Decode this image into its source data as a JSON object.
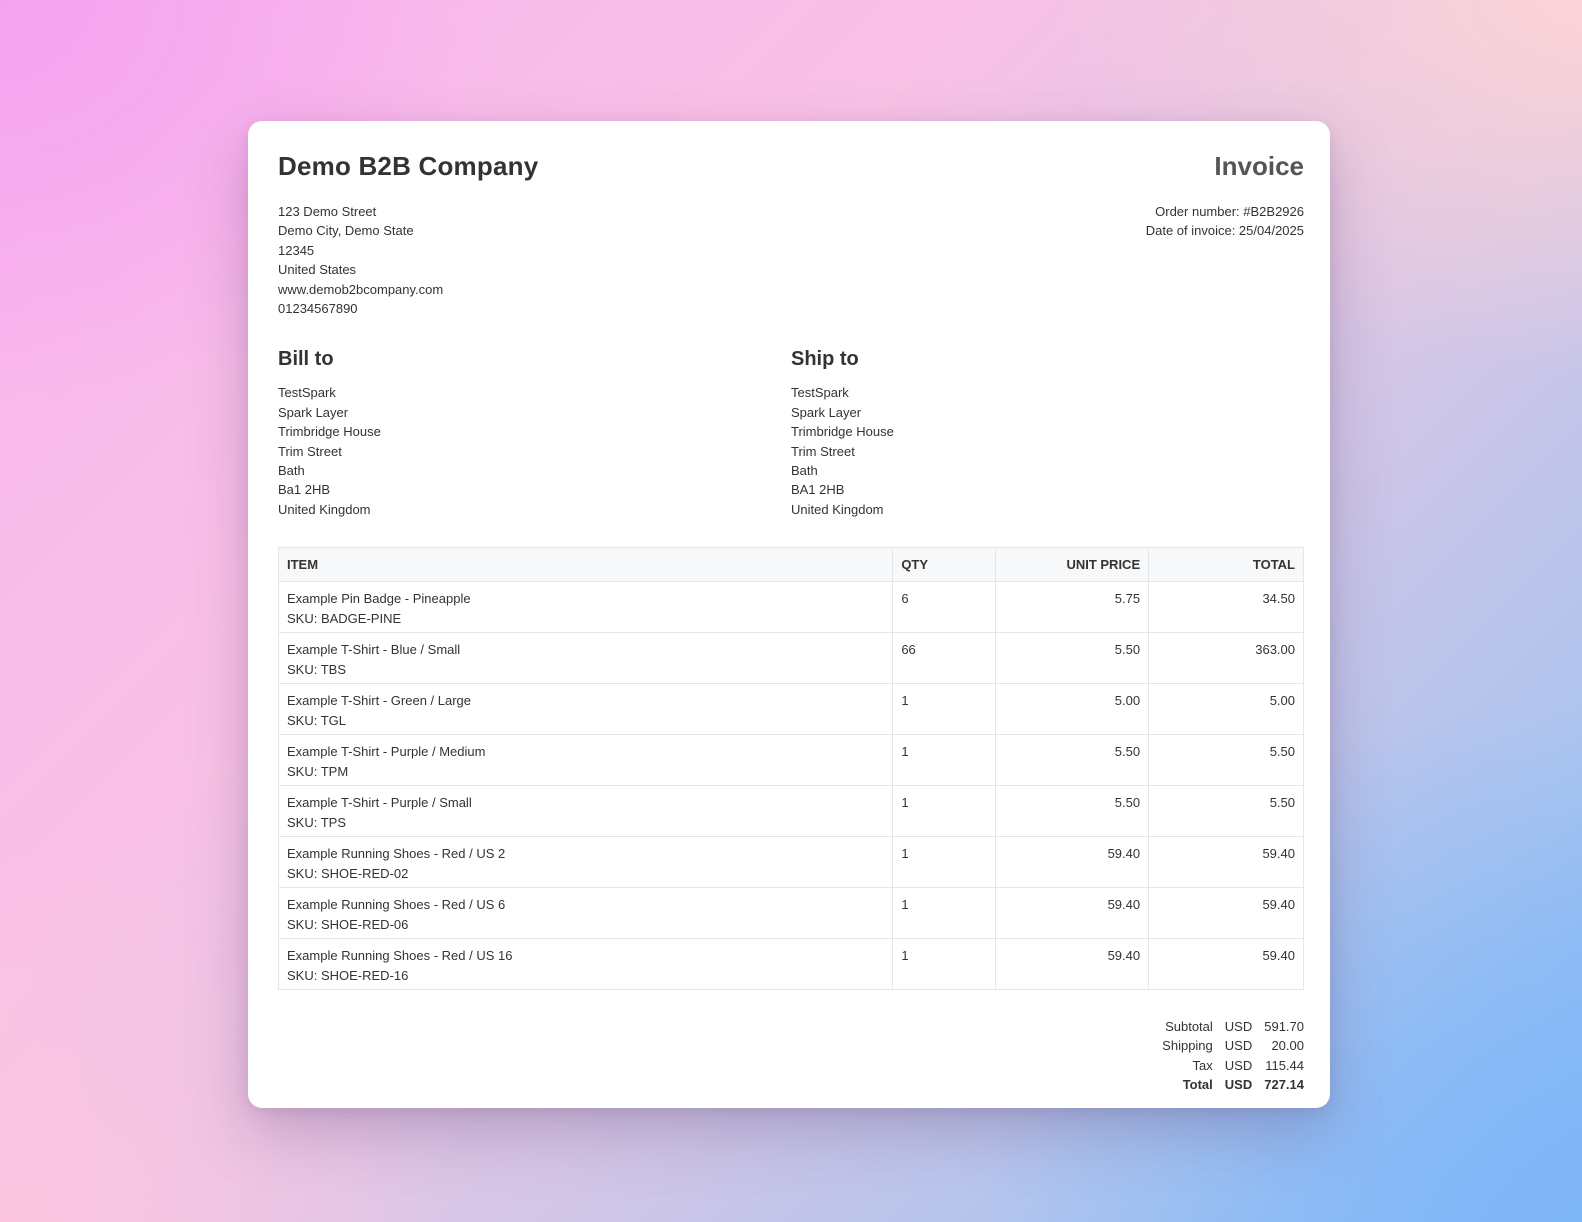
{
  "company": {
    "name": "Demo B2B Company",
    "address_lines": [
      "123 Demo Street",
      "Demo City, Demo State",
      "12345",
      "United States",
      "www.demob2bcompany.com",
      "01234567890"
    ]
  },
  "invoice": {
    "title": "Invoice",
    "order_number": "Order number: #B2B2926",
    "date": "Date of invoice: 25/04/2025"
  },
  "bill_to": {
    "title": "Bill to",
    "lines": [
      "TestSpark",
      "Spark Layer",
      "Trimbridge House",
      "Trim Street",
      "Bath",
      "Ba1 2HB",
      "United Kingdom"
    ]
  },
  "ship_to": {
    "title": "Ship to",
    "lines": [
      "TestSpark",
      "Spark Layer",
      "Trimbridge House",
      "Trim Street",
      "Bath",
      "BA1 2HB",
      "United Kingdom"
    ]
  },
  "table": {
    "headers": [
      "ITEM",
      "QTY",
      "UNIT PRICE",
      "TOTAL"
    ],
    "rows": [
      {
        "name": "Example Pin Badge - Pineapple",
        "sku": "SKU: BADGE-PINE",
        "qty": "6",
        "unit_price": "5.75",
        "total": "34.50"
      },
      {
        "name": "Example T-Shirt - Blue / Small",
        "sku": "SKU: TBS",
        "qty": "66",
        "unit_price": "5.50",
        "total": "363.00"
      },
      {
        "name": "Example T-Shirt - Green / Large",
        "sku": "SKU: TGL",
        "qty": "1",
        "unit_price": "5.00",
        "total": "5.00"
      },
      {
        "name": "Example T-Shirt - Purple / Medium",
        "sku": "SKU: TPM",
        "qty": "1",
        "unit_price": "5.50",
        "total": "5.50"
      },
      {
        "name": "Example T-Shirt - Purple / Small",
        "sku": "SKU: TPS",
        "qty": "1",
        "unit_price": "5.50",
        "total": "5.50"
      },
      {
        "name": "Example Running Shoes - Red / US 2",
        "sku": "SKU: SHOE-RED-02",
        "qty": "1",
        "unit_price": "59.40",
        "total": "59.40"
      },
      {
        "name": "Example Running Shoes - Red / US 6",
        "sku": "SKU: SHOE-RED-06",
        "qty": "1",
        "unit_price": "59.40",
        "total": "59.40"
      },
      {
        "name": "Example Running Shoes - Red / US 16",
        "sku": "SKU: SHOE-RED-16",
        "qty": "1",
        "unit_price": "59.40",
        "total": "59.40"
      }
    ]
  },
  "totals": [
    {
      "label": "Subtotal",
      "currency": "USD",
      "amount": "591.70"
    },
    {
      "label": "Shipping",
      "currency": "USD",
      "amount": "20.00"
    },
    {
      "label": "Tax",
      "currency": "USD",
      "amount": "115.44"
    },
    {
      "label": "Total",
      "currency": "USD",
      "amount": "727.14"
    }
  ]
}
